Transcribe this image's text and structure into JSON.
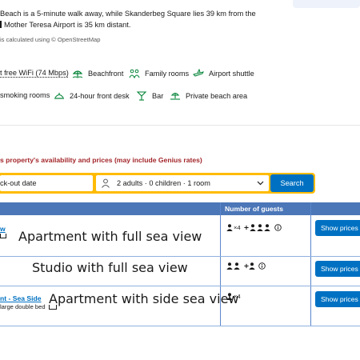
{
  "location": {
    "line1": "Beach is a 5-minute walk away, while Skanderbeg Square lies 39 km from the",
    "line2": "Mother Teresa Airport is 35 km distant.",
    "osm_note": "is calculated using © OpenStreetMap"
  },
  "amenities": {
    "row1": [
      {
        "label": "t free WiFi (74 Mbps)",
        "icon": "wifi-icon"
      },
      {
        "label": "Beachfront",
        "icon": "beach-umbrella-icon"
      },
      {
        "label": "Family rooms",
        "icon": "family-icon"
      },
      {
        "label": "Airport shuttle",
        "icon": "shuttle-icon"
      }
    ],
    "row2": [
      {
        "label": "smoking rooms",
        "icon": "no-smoking-icon"
      },
      {
        "label": "24-hour front desk",
        "icon": "front-desk-icon"
      },
      {
        "label": "Bar",
        "icon": "cocktail-icon"
      },
      {
        "label": "Private beach area",
        "icon": "private-beach-icon"
      }
    ]
  },
  "availability": {
    "title": "s property's availability and prices (may include Genius rates)",
    "checkout_label": "ck-out date",
    "guests_value": "2 adults · 0 children · 1 room",
    "search_label": "Search"
  },
  "table": {
    "col_guests": "Number of guests",
    "rows": [
      {
        "overlay": "Apartment with full sea view",
        "link_fragment": "w",
        "occupancy_text": "×4",
        "button": "Show prices"
      },
      {
        "overlay": "Studio with full sea view",
        "occupancy_text": "",
        "button": "Show prices"
      },
      {
        "overlay": "Apartment with side sea view",
        "link_fragment": "nt - Sea Side",
        "bed": "large double bed",
        "occupancy_text": "×4",
        "button": "Show prices"
      }
    ]
  },
  "colors": {
    "brand_blue": "#0071c2",
    "header_blue": "#4b76b8",
    "search_yellow": "#febb02",
    "alert_red": "#a3262a",
    "amenity_green": "#008234"
  }
}
